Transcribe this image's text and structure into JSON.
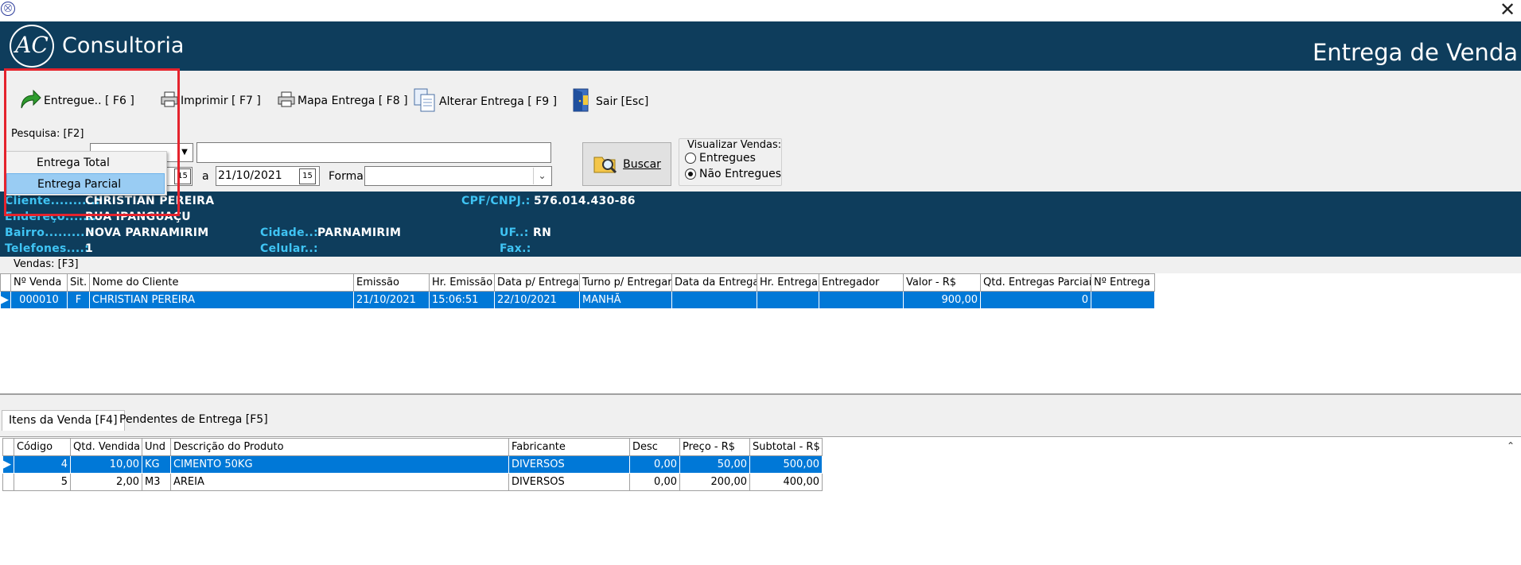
{
  "window": {
    "close_icon": "close-icon",
    "app_icon": "cart-icon"
  },
  "banner": {
    "logo_letters": "AC",
    "brand": "Consultoria",
    "title": "Entrega de Venda"
  },
  "toolbar": {
    "entregue": "Entregue.. [ F6 ]",
    "imprimir": "Imprimir  [ F7 ]",
    "mapa": "Mapa Entrega  [ F8 ]",
    "alterar": "Alterar Entrega [ F9 ]",
    "sair": "Sair [Esc]"
  },
  "search": {
    "label": "Pesquisa: [F2]",
    "text_value": "",
    "date_sep": "a",
    "date_to": "21/10/2021",
    "forma_label": "Forma:",
    "forma_value": "",
    "buscar": "Buscar",
    "visualizar_label": "Visualizar Vendas:",
    "opt_entregues": "Entregues",
    "opt_nao_entregues": "Não Entregues"
  },
  "menu": {
    "item1": "Entrega Total",
    "item2": "Entrega Parcial"
  },
  "cliente": {
    "cliente_label": "Cliente..........:",
    "cliente": "CHRISTIAN PEREIRA",
    "cpf_label": "CPF/CNPJ.:",
    "cpf": "576.014.430-86",
    "endereco_label": "Endereço......:",
    "endereco": "RUA IPANGUAÇU",
    "bairro_label": "Bairro..........:",
    "bairro": "NOVA PARNAMIRIM",
    "cidade_label": "Cidade..:",
    "cidade": "PARNAMIRIM",
    "uf_label": "UF..:",
    "uf": "RN",
    "telefones_label": "Telefones....:",
    "telefones": "1",
    "celular_label": "Celular..:",
    "fax_label": "Fax.:"
  },
  "vendas": {
    "label": "Vendas: [F3]",
    "headers": [
      "Nº Venda",
      "Sit.",
      "Nome do Cliente",
      "Emissão",
      "Hr. Emissão",
      "Data p/ Entregar",
      "Turno p/ Entregar",
      "Data da Entrega",
      "Hr. Entrega",
      "Entregador",
      "Valor - R$",
      "Qtd. Entregas Parciais",
      "Nº Entrega"
    ],
    "row": [
      "000010",
      "F",
      "CHRISTIAN PEREIRA",
      "21/10/2021",
      "15:06:51",
      "22/10/2021",
      "MANHÃ",
      "",
      "",
      "",
      "900,00",
      "0",
      ""
    ]
  },
  "tabs": {
    "itens": "Itens da Venda [F4]",
    "pendentes": "Pendentes de Entrega [F5]"
  },
  "itens": {
    "headers": [
      "Código",
      "Qtd. Vendida",
      "Und",
      "Descrição do Produto",
      "Fabricante",
      "Desc",
      "Preço - R$",
      "Subtotal - R$"
    ],
    "rows": [
      [
        "4",
        "10,00",
        "KG",
        "CIMENTO 50KG",
        "DIVERSOS",
        "0,00",
        "50,00",
        "500,00"
      ],
      [
        "5",
        "2,00",
        "M3",
        "AREIA",
        "DIVERSOS",
        "0,00",
        "200,00",
        "400,00"
      ]
    ]
  }
}
